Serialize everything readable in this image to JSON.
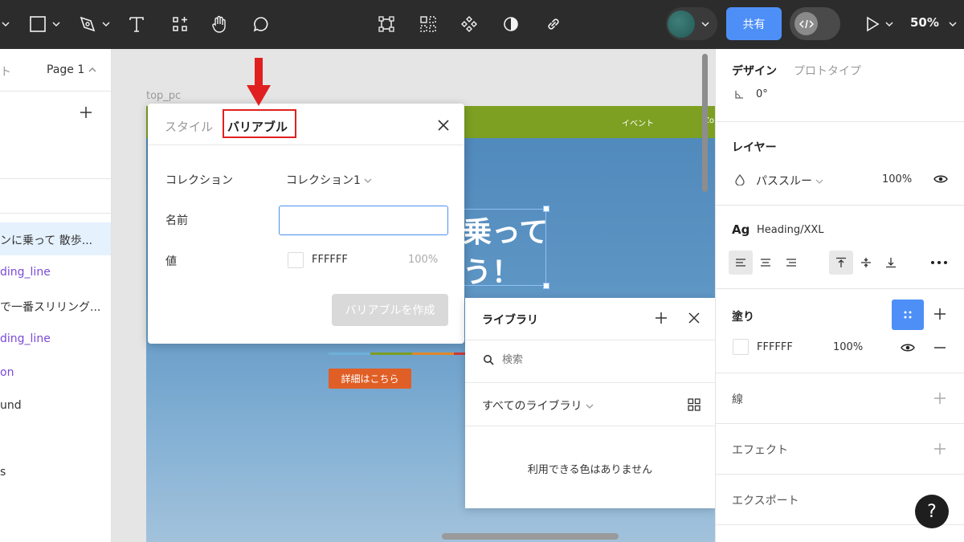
{
  "toolbar": {
    "share_label": "共有",
    "zoom_label": "50%",
    "icons": [
      "frame-tool-icon",
      "shape-tool-icon",
      "pen-tool-icon",
      "text-tool-icon",
      "components-icon",
      "hand-tool-icon",
      "comment-tool-icon",
      "frame-bounds-icon",
      "grid-icon",
      "component-icon",
      "contrast-icon",
      "link-icon",
      "play-icon",
      "dev-mode-icon"
    ]
  },
  "left_panel": {
    "tab_partial": "ト",
    "page_label": "Page 1",
    "layers": [
      {
        "label": "ンに乗って 散歩...",
        "color": "#333333",
        "selected": true
      },
      {
        "label": "ding_line",
        "color": "#7b4ad8",
        "selected": false
      },
      {
        "label": "で一番スリリング...",
        "color": "#333333",
        "selected": false
      },
      {
        "label": "ding_line",
        "color": "#7b4ad8",
        "selected": false
      },
      {
        "label": "on",
        "color": "#7b4ad8",
        "selected": false
      },
      {
        "label": "und",
        "color": "#333333",
        "selected": false
      },
      {
        "label": "s",
        "color": "#333333",
        "selected": false
      }
    ]
  },
  "canvas": {
    "frame_label": "top_pc",
    "nav_items": [
      "イベント",
      "Zo"
    ],
    "hero_line1": "乗って",
    "hero_line2": "う！",
    "cta_label": "詳細はこちら"
  },
  "variable_dialog": {
    "tab_style": "スタイル",
    "tab_variable": "バリアブル",
    "collection_label": "コレクション",
    "collection_value": "コレクション1",
    "name_label": "名前",
    "name_value": "",
    "value_label": "値",
    "color_hex": "FFFFFF",
    "opacity": "100%",
    "create_button": "バリアブルを作成"
  },
  "library": {
    "title": "ライブラリ",
    "search_placeholder": "検索",
    "filter_label": "すべてのライブラリ",
    "empty_text": "利用できる色はありません"
  },
  "right_panel": {
    "tab_design": "デザイン",
    "tab_prototype": "プロトタイプ",
    "rotation": "0°",
    "layer_heading": "レイヤー",
    "blend_mode": "パススルー",
    "layer_opacity": "100%",
    "text_style_prefix": "Ag",
    "text_style_name": "Heading/XXL",
    "fill_heading": "塗り",
    "fill_hex": "FFFFFF",
    "fill_opacity": "100%",
    "stroke_heading": "線",
    "effect_heading": "エフェクト",
    "export_heading": "エクスポート"
  },
  "help_label": "?",
  "colors": {
    "toolbar_bg": "#2c2c2c",
    "accent_blue": "#4d8ff7",
    "highlight_red": "#e02020",
    "nav_green": "#7da022",
    "cta_orange": "#e05f26",
    "variable_purple": "#7b4ad8"
  }
}
